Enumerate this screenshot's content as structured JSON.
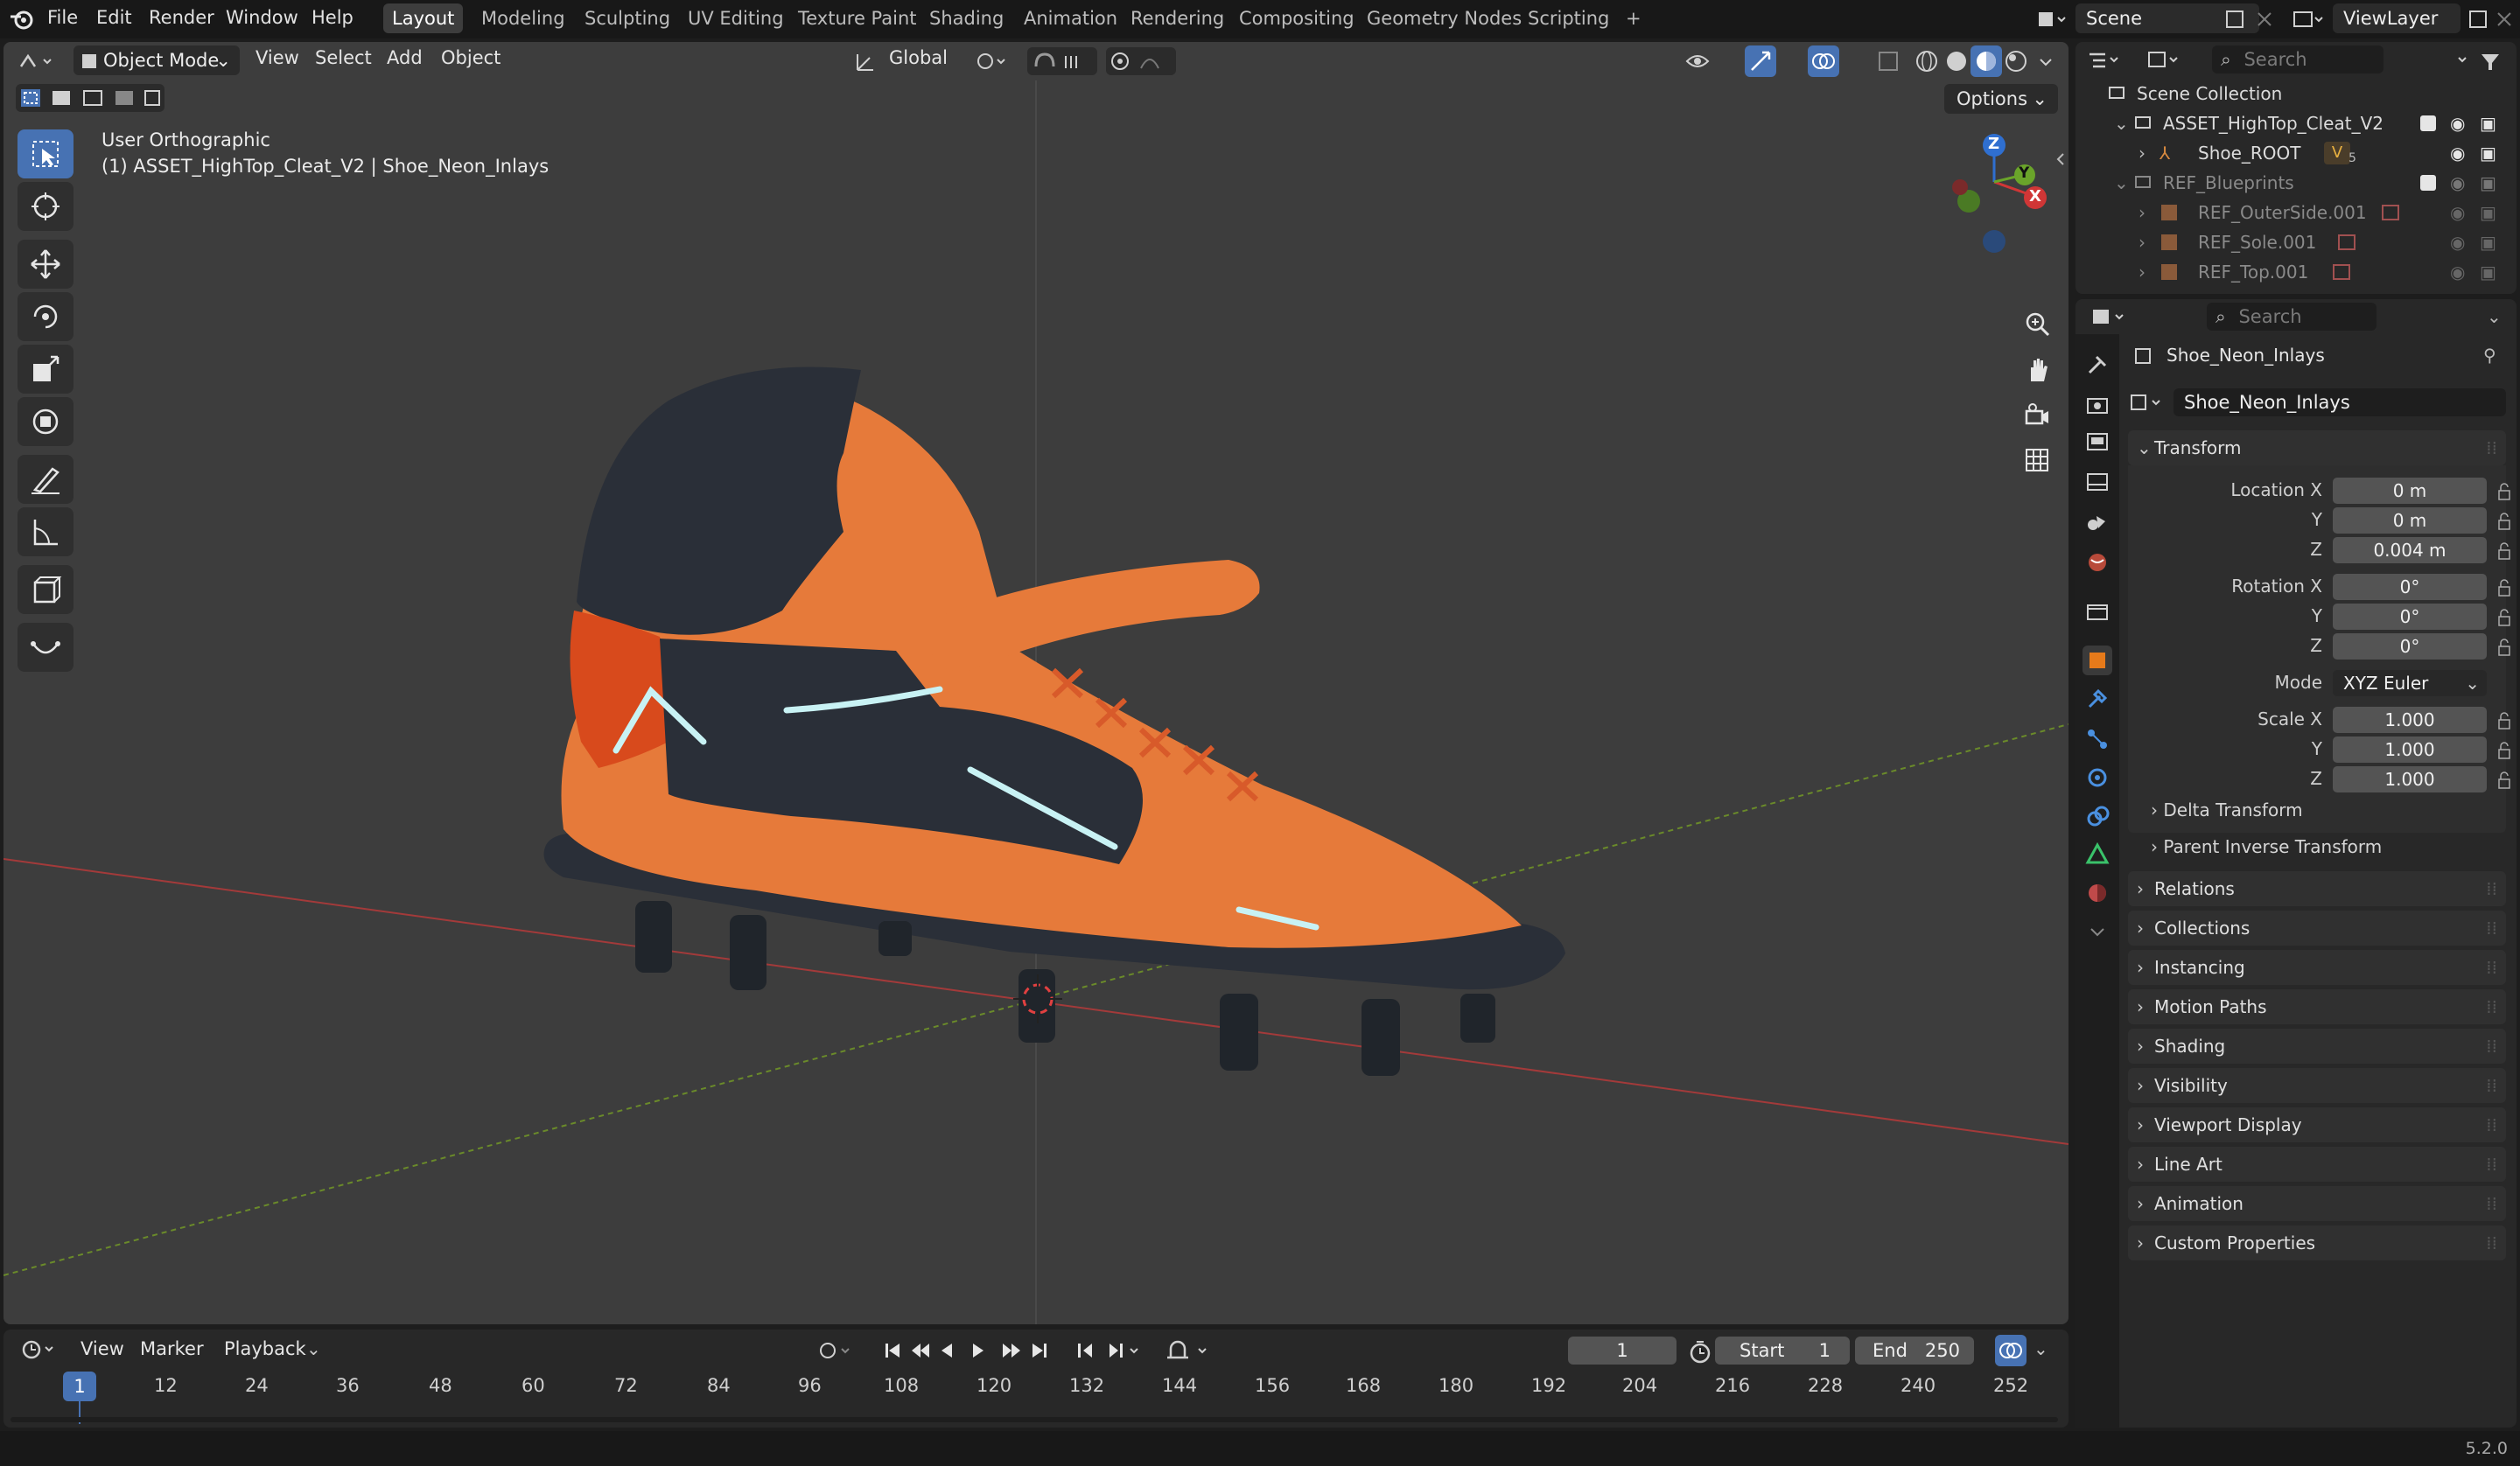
{
  "menus": [
    "File",
    "Edit",
    "Render",
    "Window",
    "Help"
  ],
  "workspaces": [
    "Layout",
    "Modeling",
    "Sculpting",
    "UV Editing",
    "Texture Paint",
    "Shading",
    "Animation",
    "Rendering",
    "Compositing",
    "Geometry Nodes",
    "Scripting"
  ],
  "active_workspace": "Layout",
  "add_workspace_label": "+",
  "scene": {
    "name": "Scene",
    "view_layer": "ViewLayer"
  },
  "viewport": {
    "mode": "Object Mode",
    "menus": [
      "View",
      "Select",
      "Add",
      "Object"
    ],
    "orientation": "Global",
    "options_label": "Options",
    "overlay_line1": "User Orthographic",
    "overlay_line2": "(1) ASSET_HighTop_Cleat_V2 | Shoe_Neon_Inlays",
    "gizmo_axes": [
      "Z",
      "Y",
      "X"
    ]
  },
  "outliner": {
    "search_placeholder": "Search",
    "rows": [
      {
        "label": "Scene Collection"
      },
      {
        "label": "ASSET_HighTop_Cleat_V2"
      },
      {
        "label": "Shoe_ROOT",
        "badge": "5"
      },
      {
        "label": "REF_Blueprints"
      },
      {
        "label": "REF_OuterSide.001"
      },
      {
        "label": "REF_Sole.001"
      },
      {
        "label": "REF_Top.001"
      }
    ]
  },
  "properties": {
    "search_placeholder": "Search",
    "object_name": "Shoe_Neon_Inlays",
    "object_field": "Shoe_Neon_Inlays",
    "transform": {
      "title": "Transform",
      "location_label": "Location X",
      "loc_x": "0 m",
      "loc_y": "0 m",
      "loc_z": "0.004 m",
      "rotation_label": "Rotation X",
      "rot_x": "0°",
      "rot_y": "0°",
      "rot_z": "0°",
      "mode_label": "Mode",
      "mode": "XYZ Euler",
      "scale_label": "Scale X",
      "scale_x": "1.000",
      "scale_y": "1.000",
      "scale_z": "1.000",
      "y_label": "Y",
      "z_label": "Z",
      "delta": "Delta Transform",
      "parent_inverse": "Parent Inverse Transform"
    },
    "panels": [
      "Relations",
      "Collections",
      "Instancing",
      "Motion Paths",
      "Shading",
      "Visibility",
      "Viewport Display",
      "Line Art",
      "Animation",
      "Custom Properties"
    ]
  },
  "timeline": {
    "menus": [
      "View",
      "Marker",
      "Playback"
    ],
    "current_frame": "1",
    "start_label": "Start",
    "start": "1",
    "end_label": "End",
    "end": "250",
    "playhead": "1",
    "ticks": [
      "12",
      "24",
      "36",
      "48",
      "60",
      "72",
      "84",
      "96",
      "108",
      "120",
      "132",
      "144",
      "156",
      "168",
      "180",
      "192",
      "204",
      "216",
      "228",
      "240",
      "252"
    ]
  },
  "version": "5.2.0",
  "colors": {
    "accent": "#4772b3",
    "shoe_orange": "#e67a3a",
    "shoe_dark": "#2a2f38",
    "neon": "#c8f2f4"
  }
}
